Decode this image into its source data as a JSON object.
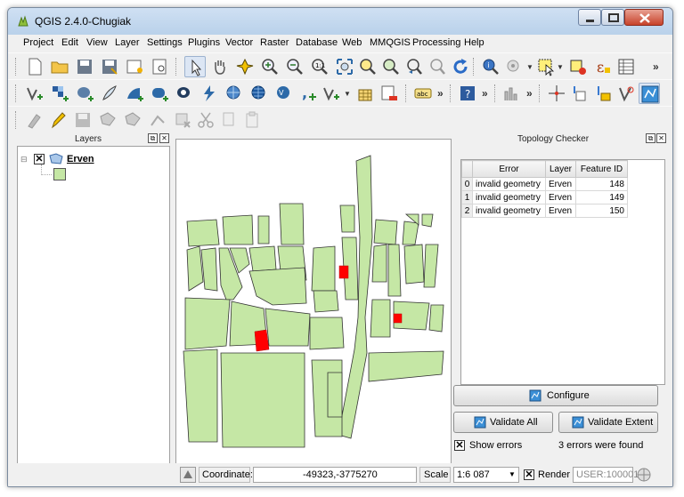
{
  "window": {
    "title": "QGIS 2.4.0-Chugiak"
  },
  "menu": [
    "Project",
    "Edit",
    "View",
    "Layer",
    "Settings",
    "Plugins",
    "Vector",
    "Raster",
    "Database",
    "Web",
    "MMQGIS",
    "Processing",
    "Help"
  ],
  "toolbar_overflow": "»",
  "layers_panel": {
    "title": "Layers",
    "layer": {
      "name": "Erven",
      "visible": true
    }
  },
  "topology_panel": {
    "title": "Topology Checker",
    "columns": [
      "Error",
      "Layer",
      "Feature ID"
    ],
    "rows": [
      {
        "index": "0",
        "error": "invalid geometry",
        "layer": "Erven",
        "feature_id": "148"
      },
      {
        "index": "1",
        "error": "invalid geometry",
        "layer": "Erven",
        "feature_id": "149"
      },
      {
        "index": "2",
        "error": "invalid geometry",
        "layer": "Erven",
        "feature_id": "150"
      }
    ],
    "configure_label": "Configure",
    "validate_all_label": "Validate All",
    "validate_extent_label": "Validate Extent",
    "show_errors_label": "Show errors",
    "show_errors_checked": true,
    "status_text": "3 errors were found"
  },
  "statusbar": {
    "coordinate_label": "Coordinate:",
    "coordinate_value": "-49323,-3775270",
    "scale_label": "Scale",
    "scale_value": "1:6 087",
    "render_label": "Render",
    "render_checked": true,
    "crs": "USER:100001"
  },
  "colors": {
    "parcel_fill": "#c5e7a5",
    "parcel_stroke": "#333333",
    "error_fill": "#ff0000",
    "title_bar": "#c4d8ee"
  }
}
